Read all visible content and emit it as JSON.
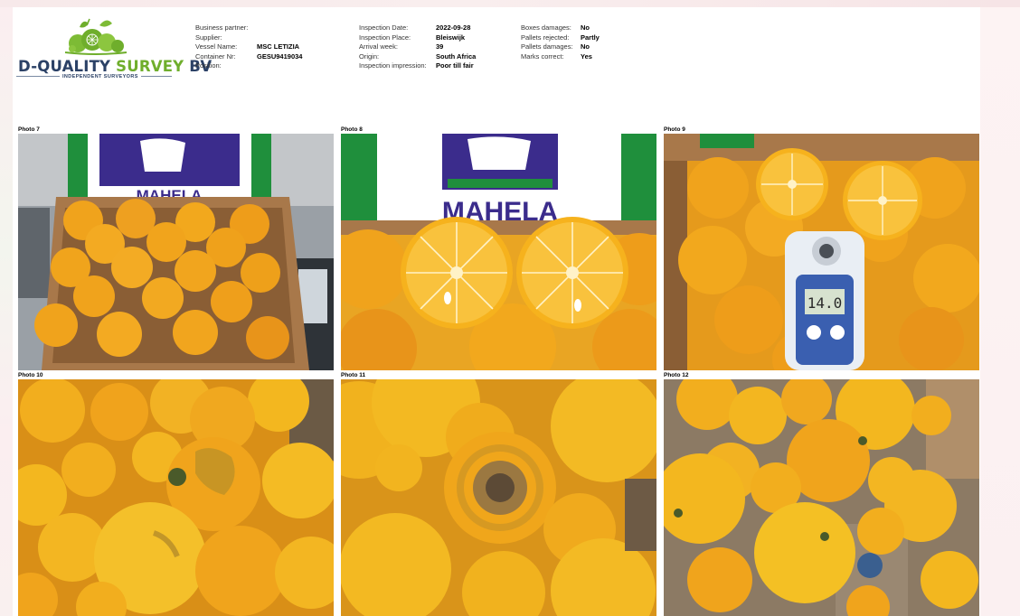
{
  "logo": {
    "name_part1": "D-QUALITY",
    "name_part2": "SURVEY",
    "name_part3": "BV",
    "tagline": "INDEPENDENT SURVEYORS",
    "brand_blue": "#2b4166",
    "brand_green": "#6fae2c"
  },
  "info_col1": [
    {
      "label": "Business partner:",
      "value": ""
    },
    {
      "label": "Supplier:",
      "value": ""
    },
    {
      "label": "Vessel Name:",
      "value": "MSC LETIZIA"
    },
    {
      "label": "Container Nr:",
      "value": "GESU9419034"
    },
    {
      "label": "Position:",
      "value": ""
    }
  ],
  "info_col2": [
    {
      "label": "Inspection Date:",
      "value": "2022-09-28"
    },
    {
      "label": "Inspection Place:",
      "value": "Bleiswijk"
    },
    {
      "label": "Arrival week:",
      "value": "39"
    },
    {
      "label": "Origin:",
      "value": "South Africa"
    },
    {
      "label": "Inspection impression:",
      "value": "Poor till fair"
    }
  ],
  "info_col3": [
    {
      "label": "Boxes damages:",
      "value": "No"
    },
    {
      "label": "Pallets rejected:",
      "value": "Partly"
    },
    {
      "label": "Pallets damages:",
      "value": "No"
    },
    {
      "label": "Marks correct:",
      "value": "Yes"
    }
  ],
  "photos": [
    {
      "label": "Photo 7",
      "box_text": "MAHELA",
      "icon": "crate-of-oranges-photo"
    },
    {
      "label": "Photo 8",
      "box_text": "MAHELA",
      "icon": "halved-orange-photo"
    },
    {
      "label": "Photo 9",
      "meter_reading": "14.0",
      "icon": "brix-meter-photo"
    },
    {
      "label": "Photo 10",
      "icon": "blemished-oranges-photo"
    },
    {
      "label": "Photo 11",
      "icon": "decayed-orange-photo"
    },
    {
      "label": "Photo 12",
      "icon": "oranges-in-box-photo"
    }
  ],
  "colors": {
    "orange": "#f0a31c",
    "orange_dark": "#d9820f",
    "lemon_yellow": "#f2c21e",
    "cardboard": "#a8784a",
    "box_blue": "#3b2c8c",
    "box_green": "#1f8f3c"
  }
}
